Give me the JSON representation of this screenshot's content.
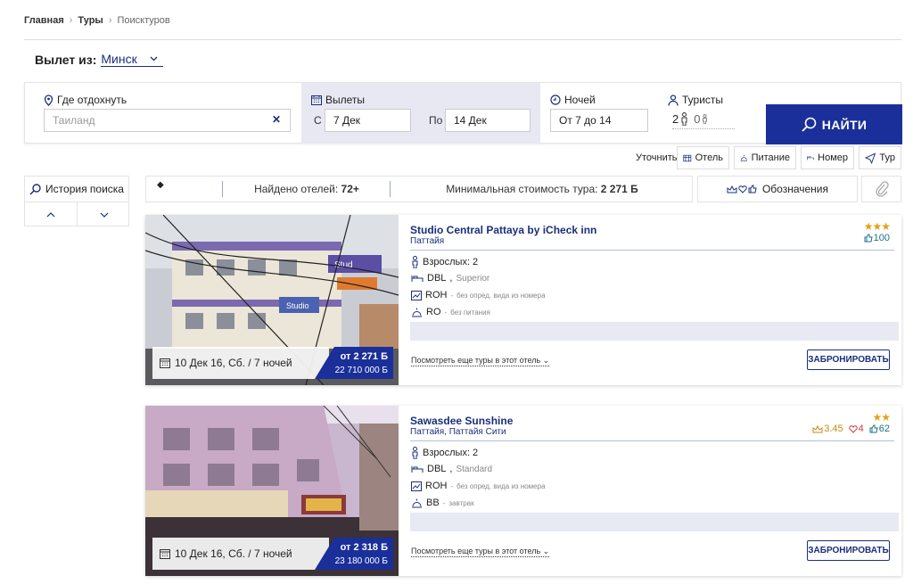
{
  "breadcrumb": {
    "home": "Главная",
    "tours": "Туры",
    "current": "Поисктуров"
  },
  "departure": {
    "label": "Вылет из:",
    "city": "Минск"
  },
  "search": {
    "where_label": "Где отдохнуть",
    "where_placeholder": "Таиланд",
    "flights_label": "Вылеты",
    "from_label": "С",
    "from_value": "7 Дек",
    "to_label": "По",
    "to_value": "14 Дек",
    "nights_label": "Ночей",
    "nights_value": "От 7 до 14",
    "tourists_label": "Туристы",
    "adults": "2",
    "children": "0",
    "find_label": "НАЙТИ"
  },
  "refine": {
    "label": "Уточнить",
    "hotel": "Отель",
    "food": "Питание",
    "room": "Номер",
    "tour": "Тур"
  },
  "history": {
    "label": "История поиска"
  },
  "stats": {
    "found_label": "Найдено отелей:",
    "found_value": "72+",
    "min_label": "Минимальная стоимость тура:",
    "min_value": "2 271 Б",
    "legend": "Обозначения"
  },
  "hotels": [
    {
      "name": "Studio Central Pattaya by iCheck inn",
      "location": "Паттайя",
      "stars": "★★★",
      "rating_reviews": "100",
      "adults": "Взрослых: 2",
      "room": "DBL",
      "room_type": "Superior",
      "view": "ROH",
      "view_note": "без опред. вида из номера",
      "meal": "RO",
      "meal_note": "без питания",
      "date": "10 Дек 16, Сб. / 7 ночей",
      "price": "от 2 271 Б",
      "price_old": "22 710 000 Б",
      "more": "Посмотреть еще туры в этот отель",
      "book": "ЗАБРОНИРОВАТЬ"
    },
    {
      "name": "Sawasdee Sunshine",
      "location": "Паттайя, Паттайя Сити",
      "stars": "★★",
      "rating_crown": "3.45",
      "rating_heart": "4",
      "rating_reviews": "62",
      "adults": "Взрослых: 2",
      "room": "DBL",
      "room_type": "Standard",
      "view": "ROH",
      "view_note": "без опред. вида из номера",
      "meal": "BB",
      "meal_note": "завтрак",
      "date": "10 Дек 16, Сб. / 7 ночей",
      "price": "от 2 318 Б",
      "price_old": "23 180 000 Б",
      "more": "Посмотреть еще туры в этот отель",
      "book": "ЗАБРОНИРОВАТЬ"
    }
  ],
  "colors": {
    "brand": "#1b2f9a",
    "dates_bg": "#e7e8f1",
    "star": "#e2a11a",
    "heart": "#d43a3a",
    "reviews": "#1d6f8a"
  }
}
